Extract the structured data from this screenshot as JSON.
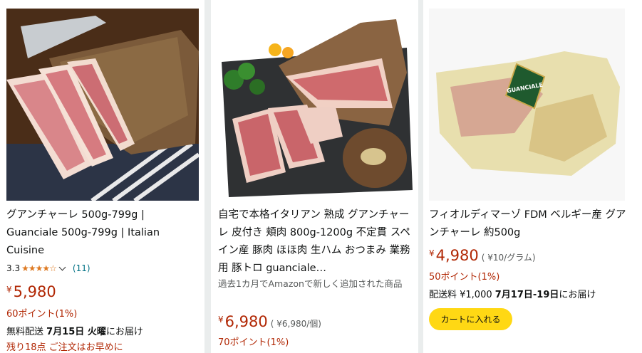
{
  "products": [
    {
      "title": "グアンチャーレ 500g-799g | Guanciale 500g-799g | Italian Cuisine",
      "rating": "3.3",
      "stars": "★★★★☆",
      "review_count": "(11)",
      "price_symbol": "¥",
      "price": "5,980",
      "points": "60ポイント(1%)",
      "ship_prefix": "無料配送",
      "ship_date": "7月15日 火曜",
      "ship_suffix": "にお届け",
      "stock_note": "残り18点 ご注文はお早めに"
    },
    {
      "title": "自宅で本格イタリアン 熟成 グアンチャーレ 皮付き 頬肉 800g-1200g 不定貫 スペイン産 豚肉 ほほ肉 生ハム おつまみ 業務用 豚トロ guanciale…",
      "new_note": "過去1カ月でAmazonで新しく追加された商品",
      "price_symbol": "¥",
      "price": "6,980",
      "unit_price": "( ¥6,980/個)",
      "points": "70ポイント(1%)"
    },
    {
      "title": "フィオルディマーゾ FDM ベルギー産 グアンチャーレ 約500g",
      "price_symbol": "¥",
      "price": "4,980",
      "unit_price": "( ¥10/グラム)",
      "points": "50ポイント(1%)",
      "ship_prefix": "配送料 ¥1,000",
      "ship_date": "7月17日-19日",
      "ship_suffix": "にお届け",
      "cart_button": "カートに入れる",
      "badge_text": "GUANCIALE"
    }
  ]
}
